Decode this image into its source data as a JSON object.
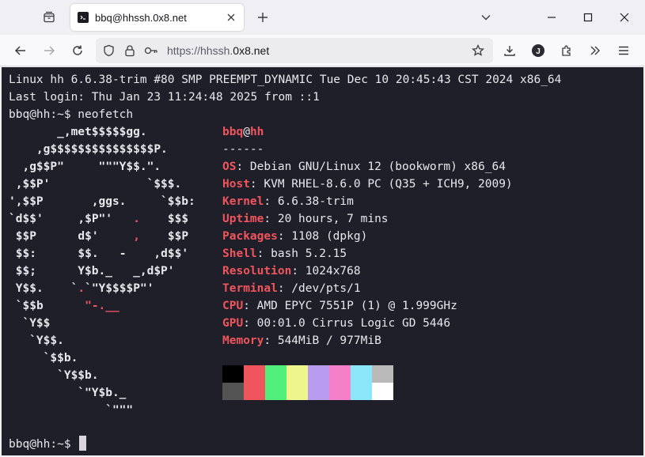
{
  "tab": {
    "title": "bbq@hhssh.0x8.net"
  },
  "url": {
    "prefix": "https://hhssh.",
    "domain": "0x8.net"
  },
  "terminal": {
    "header_lines": [
      "Linux hh 6.6.38-trim #80 SMP PREEMPT_DYNAMIC Tue Dec 10 20:45:43 CST 2024 x86_64",
      "Last login: Thu Jan 23 11:24:48 2025 from ::1",
      "bbq@hh:~$ neofetch"
    ],
    "logo": [
      "       _,met$$$$$gg.",
      "    ,g$$$$$$$$$$$$$$$P.",
      "  ,g$$P\"     \"\"\"Y$$.\".",
      " ,$$P'              `$$$.",
      "',$$P       ,ggs.     `$$b:",
      "`d$$'     ,$P\"'   .    $$$",
      " $$P      d$'     ,    $$P",
      " $$:      $$.   -    ,d$$'",
      " $$;      Y$b._   _,d$P'",
      " Y$$.    `.`\"Y$$$$P\"'",
      " `$$b      \"-.__",
      "  `Y$$",
      "   `Y$$.",
      "     `$$b.",
      "       `Y$$b.",
      "          `\"Y$b._",
      "              `\"\"\""
    ],
    "user": "bbq",
    "at": "@",
    "host": "hh",
    "separator": "------",
    "info": [
      {
        "key": "OS",
        "value": "Debian GNU/Linux 12 (bookworm) x86_64"
      },
      {
        "key": "Host",
        "value": "KVM RHEL-8.6.0 PC (Q35 + ICH9, 2009)"
      },
      {
        "key": "Kernel",
        "value": "6.6.38-trim"
      },
      {
        "key": "Uptime",
        "value": "20 hours, 7 mins"
      },
      {
        "key": "Packages",
        "value": "1108 (dpkg)"
      },
      {
        "key": "Shell",
        "value": "bash 5.2.15"
      },
      {
        "key": "Resolution",
        "value": "1024x768"
      },
      {
        "key": "Terminal",
        "value": "/dev/pts/1"
      },
      {
        "key": "CPU",
        "value": "AMD EPYC 7551P (1) @ 1.999GHz"
      },
      {
        "key": "GPU",
        "value": "00:01.0 Cirrus Logic GD 5446"
      },
      {
        "key": "Memory",
        "value": "544MiB / 977MiB"
      }
    ],
    "colors_top": [
      "#000000",
      "#f0555e",
      "#50f07a",
      "#eef58c",
      "#b99cef",
      "#f57fc8",
      "#8be6f9",
      "#b9b9b9"
    ],
    "colors_bottom": [
      "#545454",
      "#f0555e",
      "#50f07a",
      "#eef58c",
      "#b99cef",
      "#f57fc8",
      "#8be6f9",
      "#ffffff"
    ],
    "prompt": "bbq@hh:~$ "
  }
}
